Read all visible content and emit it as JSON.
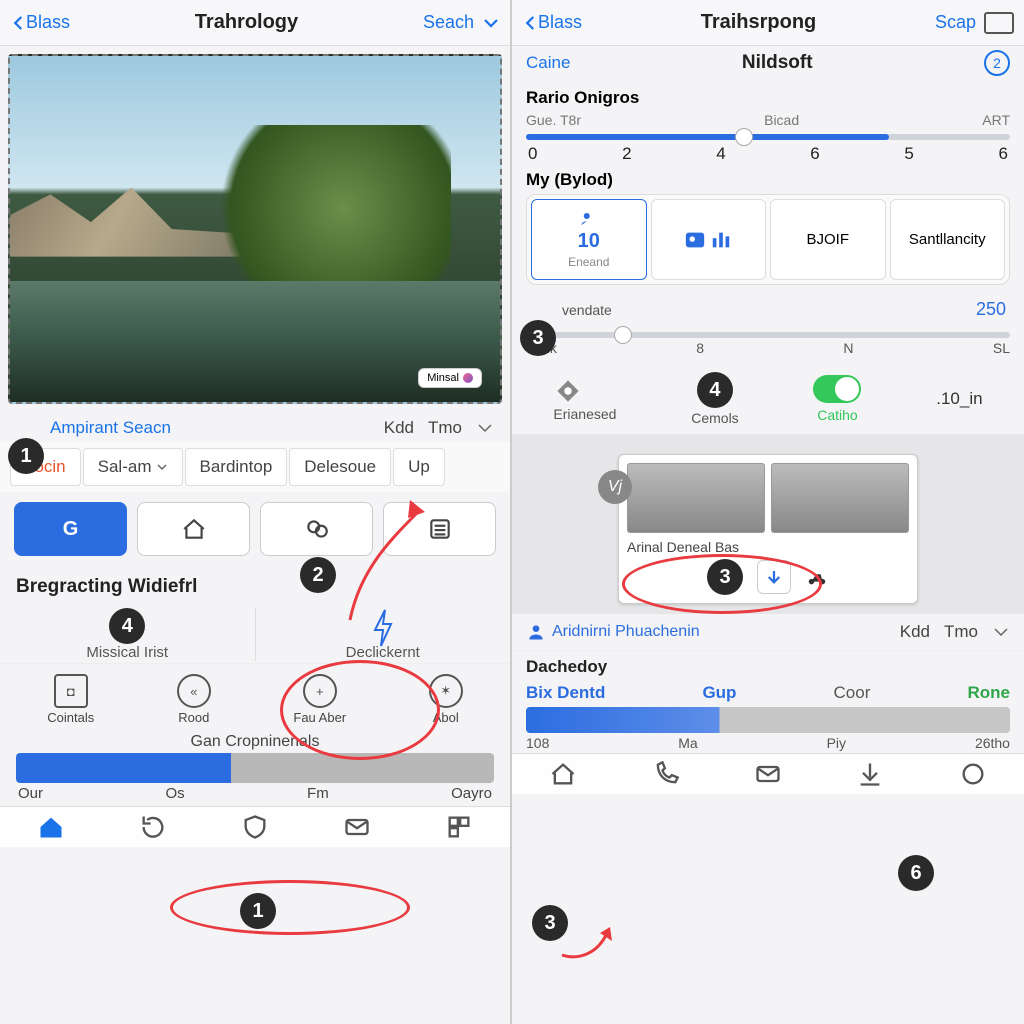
{
  "left": {
    "header": {
      "back": "Blass",
      "title": "Trahrology",
      "search": "Seach"
    },
    "hero_badge": "Minsal",
    "row1": {
      "link": "Ampirant Seacn",
      "kdd": "Kdd",
      "tmo": "Tmo"
    },
    "tabs": [
      "Locin",
      "Sal-am",
      "Bardintop",
      "Delesoue",
      "Up"
    ],
    "toolbar_g": "G",
    "section": "Bregracting Widiefrl",
    "widgets": {
      "left": "Missical Irist",
      "right": "Declickernt"
    },
    "bottom": [
      "Cointals",
      "Rood",
      "Fau Aber",
      "Abol"
    ],
    "slider": {
      "label": "Gan Cropninenals",
      "ticks": [
        "Our",
        "Os",
        "Fm",
        "Oayro"
      ]
    },
    "markers": {
      "m1": "1",
      "m2": "2",
      "m4": "4",
      "slider1": "1"
    }
  },
  "right": {
    "header": {
      "back": "Blass",
      "title": "Traihsrpong",
      "search": "Scap"
    },
    "sub": {
      "l": "Caine",
      "c": "Nildsoft",
      "badge": "2"
    },
    "panel1": {
      "title": "Rario Onigros",
      "labels": [
        "Gue. T8r",
        "Bicad",
        "ART"
      ],
      "nums": [
        "0",
        "2",
        "4",
        "6",
        "5",
        "6"
      ]
    },
    "my": "My (Bylod)",
    "seg": [
      {
        "num": "10",
        "sub": "Eneand"
      },
      {
        "label": "BJOIF"
      },
      {
        "label": "Santllancity"
      }
    ],
    "row3": {
      "label": "vendate",
      "ticks": [
        "Wolk",
        "8",
        "N",
        "SL"
      ],
      "value": "250"
    },
    "quick": {
      "a": "Erianesed",
      "b": "Cemols",
      "c": "Catiho",
      "d": ".10_in"
    },
    "thumbs": {
      "title": "Arinal Deneal Bas"
    },
    "linkrow": {
      "l": "Aridnirni Phuachenin",
      "kdd": "Kdd",
      "tmo": "Tmo"
    },
    "dach": "Dachedoy",
    "chips": [
      "Bix Dentd",
      "Gup",
      "Coor",
      "Rone"
    ],
    "rticks": [
      "108",
      "Ma",
      "Piy",
      "26tho"
    ],
    "markers": {
      "m3": "3",
      "m4": "4",
      "c3a": "3",
      "c3b": "3",
      "m6": "6"
    }
  }
}
